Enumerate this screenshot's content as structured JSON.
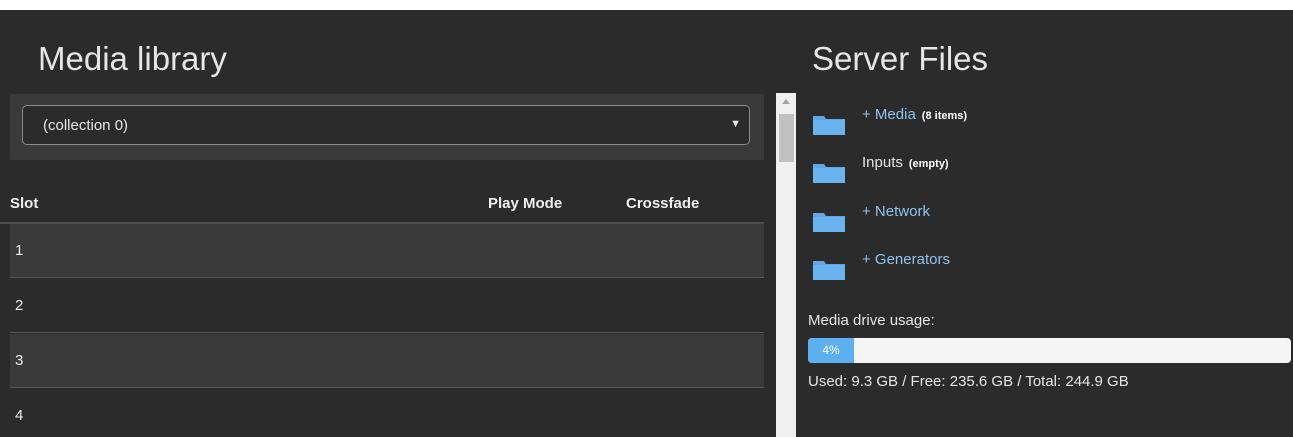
{
  "library": {
    "title": "Media library",
    "collection_select": {
      "value": "(collection 0)",
      "caret": "▼"
    },
    "columns": {
      "slot": "Slot",
      "play_mode": "Play Mode",
      "crossfade": "Crossfade"
    },
    "rows": [
      {
        "slot": "1",
        "play_mode": "",
        "crossfade": ""
      },
      {
        "slot": "2",
        "play_mode": "",
        "crossfade": ""
      },
      {
        "slot": "3",
        "play_mode": "",
        "crossfade": ""
      },
      {
        "slot": "4",
        "play_mode": "",
        "crossfade": ""
      }
    ]
  },
  "server_files": {
    "title": "Server Files",
    "items": [
      {
        "label": "+ Media",
        "count": "(8 items)",
        "icon": "folder-icon"
      },
      {
        "label": "Inputs",
        "count": "(empty)",
        "icon": "folder-icon"
      },
      {
        "label": "+ Network",
        "count": "",
        "icon": "folder-icon"
      },
      {
        "label": "+ Generators",
        "count": "",
        "icon": "folder-icon"
      }
    ],
    "usage": {
      "label": "Media drive usage:",
      "percent_label": "4%",
      "percent": 4,
      "detail": "Used: 9.3 GB / Free: 235.6 GB / Total: 244.9 GB"
    }
  },
  "colors": {
    "background": "#2b2b2b",
    "link": "#8fc3ef",
    "folder": "#5ea6e6",
    "progress": "#5cb0f0"
  }
}
